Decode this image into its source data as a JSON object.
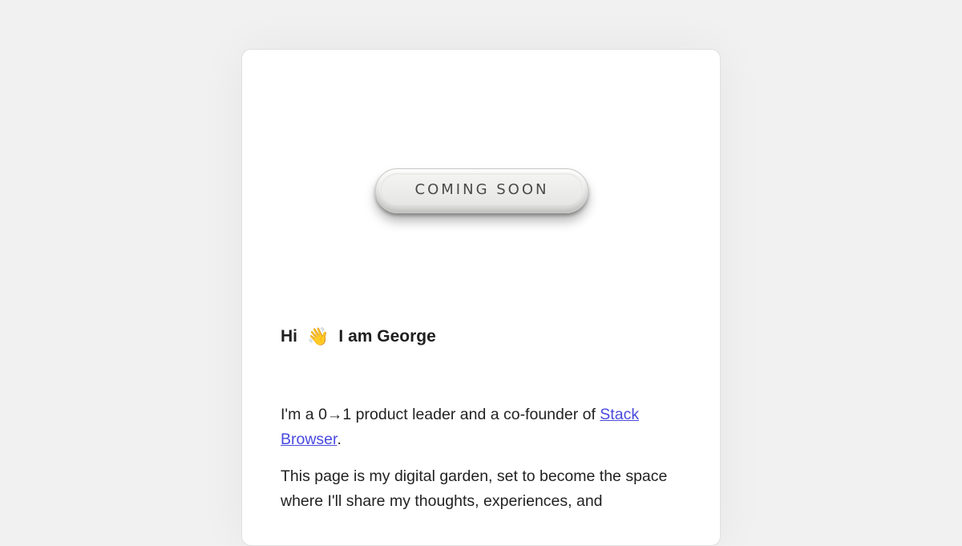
{
  "badge": {
    "label": "COMING SOON"
  },
  "greeting": {
    "hi": "Hi",
    "wave_emoji": "👋",
    "name_text": "I am George"
  },
  "intro": {
    "text_before": "I'm a 0→1 product leader and a co-founder of ",
    "link_text": "Stack Browser",
    "text_after": "."
  },
  "garden": {
    "text": "This page is my digital garden, set to become the space where I'll share my thoughts, experiences, and"
  },
  "colors": {
    "background": "#f0f1f0",
    "card": "#ffffff",
    "link": "#4a4adf",
    "text": "#222222"
  }
}
